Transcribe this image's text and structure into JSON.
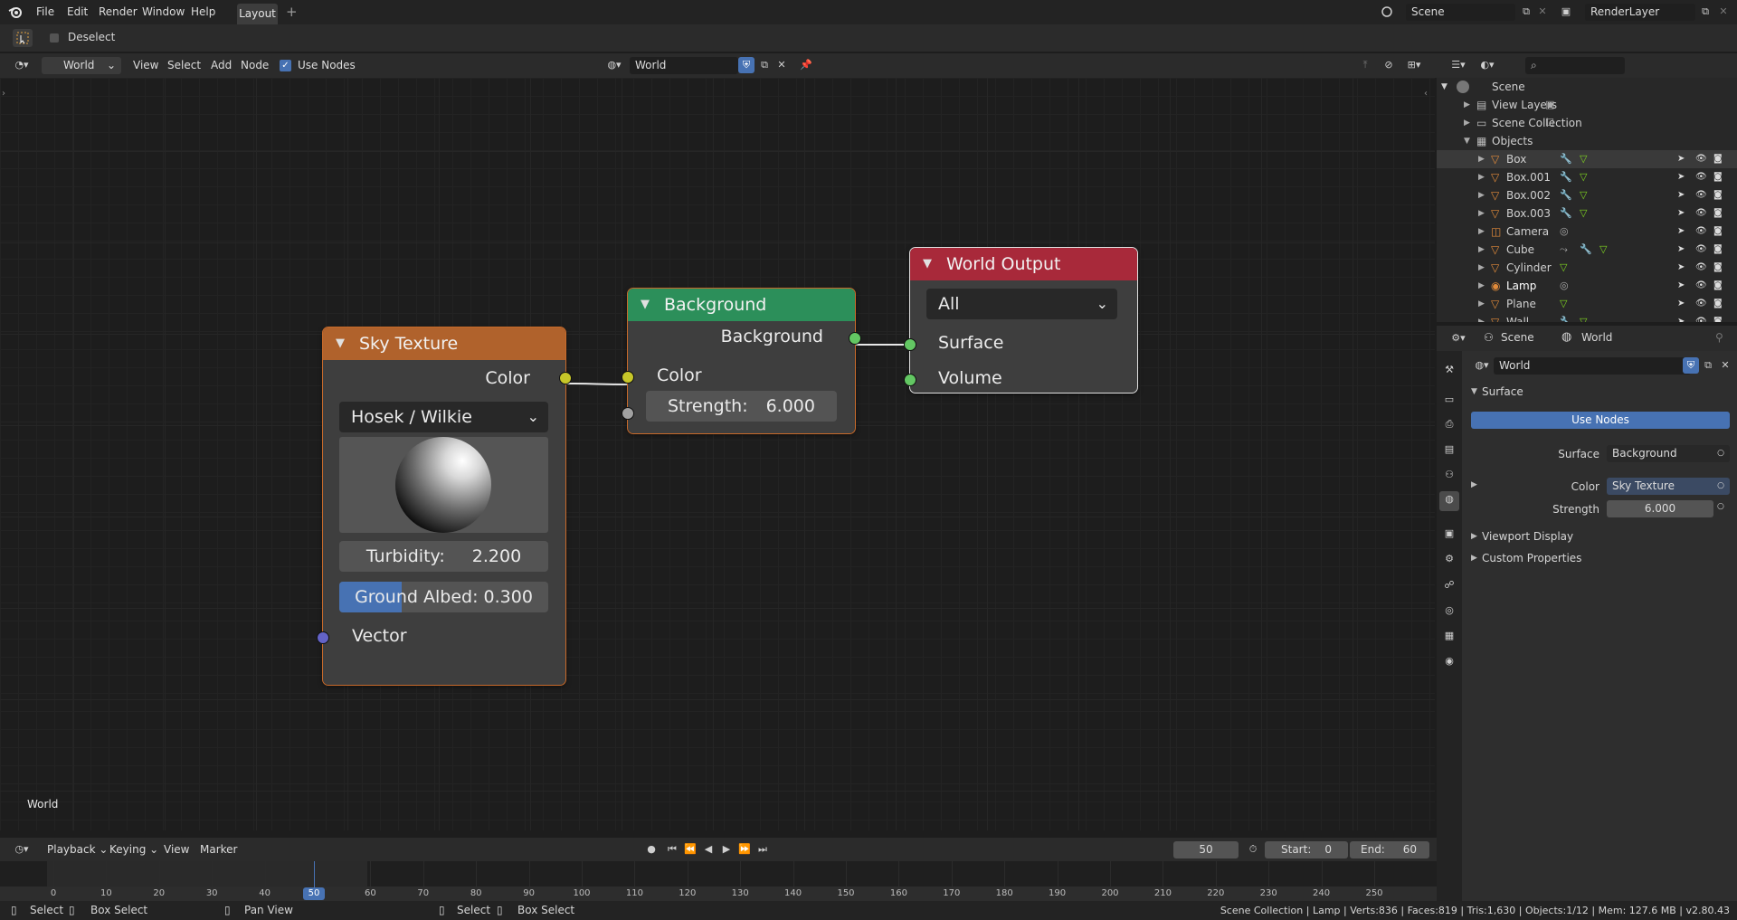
{
  "topbar": {
    "menus": [
      "File",
      "Edit",
      "Render",
      "Window",
      "Help"
    ],
    "tab": "Layout",
    "scene": "Scene",
    "render_layer": "RenderLayer"
  },
  "toolbar": {
    "deselect": "Deselect"
  },
  "node_header": {
    "world_type": "World",
    "menus": [
      "View",
      "Select",
      "Add",
      "Node"
    ],
    "use_nodes": "Use Nodes",
    "world_name": "World"
  },
  "nodes": {
    "sky": {
      "title": "Sky Texture",
      "color_out": "Color",
      "model": "Hosek / Wilkie",
      "turbidity_label": "Turbidity:",
      "turbidity": "2.200",
      "albedo_label": "Ground Albed:",
      "albedo": "0.300",
      "albedo_fraction": 0.3,
      "vector": "Vector",
      "header_color": "#b0622c"
    },
    "background": {
      "title": "Background",
      "out": "Background",
      "color_in": "Color",
      "strength_label": "Strength:",
      "strength": "6.000",
      "header_color": "#2c8f5a"
    },
    "output": {
      "title": "World Output",
      "target": "All",
      "surface": "Surface",
      "volume": "Volume",
      "header_color": "#a8293a"
    }
  },
  "editor_label": "World",
  "outliner": {
    "root": "Scene",
    "items": [
      {
        "label": "View Layers"
      },
      {
        "label": "Scene Collection"
      },
      {
        "label": "Objects"
      },
      {
        "label": "Box"
      },
      {
        "label": "Box.001"
      },
      {
        "label": "Box.002"
      },
      {
        "label": "Box.003"
      },
      {
        "label": "Camera"
      },
      {
        "label": "Cube"
      },
      {
        "label": "Cylinder"
      },
      {
        "label": "Lamp"
      },
      {
        "label": "Plane"
      },
      {
        "label": "Wall"
      }
    ]
  },
  "properties": {
    "crumb_scene": "Scene",
    "crumb_world": "World",
    "world_name": "World",
    "surface_panel": "Surface",
    "use_nodes": "Use Nodes",
    "surface_label": "Surface",
    "surface_value": "Background",
    "color_label": "Color",
    "color_value": "Sky Texture",
    "strength_label": "Strength",
    "strength_value": "6.000",
    "viewport_display": "Viewport Display",
    "custom_properties": "Custom Properties"
  },
  "timeline": {
    "menus": [
      "Playback",
      "Keying",
      "View",
      "Marker"
    ],
    "current_frame": "50",
    "start_label": "Start:",
    "start": "0",
    "end_label": "End:",
    "end": "60",
    "ticks": [
      "0",
      "10",
      "20",
      "30",
      "40",
      "50",
      "60",
      "70",
      "80",
      "90",
      "100",
      "110",
      "120",
      "130",
      "140",
      "150",
      "160",
      "170",
      "180",
      "190",
      "200",
      "210",
      "220",
      "230",
      "240",
      "250"
    ]
  },
  "statusbar": {
    "select": "Select",
    "box_select": "Box Select",
    "pan_view": "Pan View",
    "select2": "Select",
    "box_select2": "Box Select",
    "info": "Scene Collection | Lamp | Verts:836 | Faces:819 | Tris:1,630 | Objects:1/12 | Mem: 127.6 MB | v2.80.43"
  },
  "colors": {
    "accent": "#4772b3",
    "socket_yellow": "#c7c729",
    "socket_green": "#63c763",
    "socket_grey": "#a1a1a1",
    "socket_blue": "#6363c7"
  }
}
